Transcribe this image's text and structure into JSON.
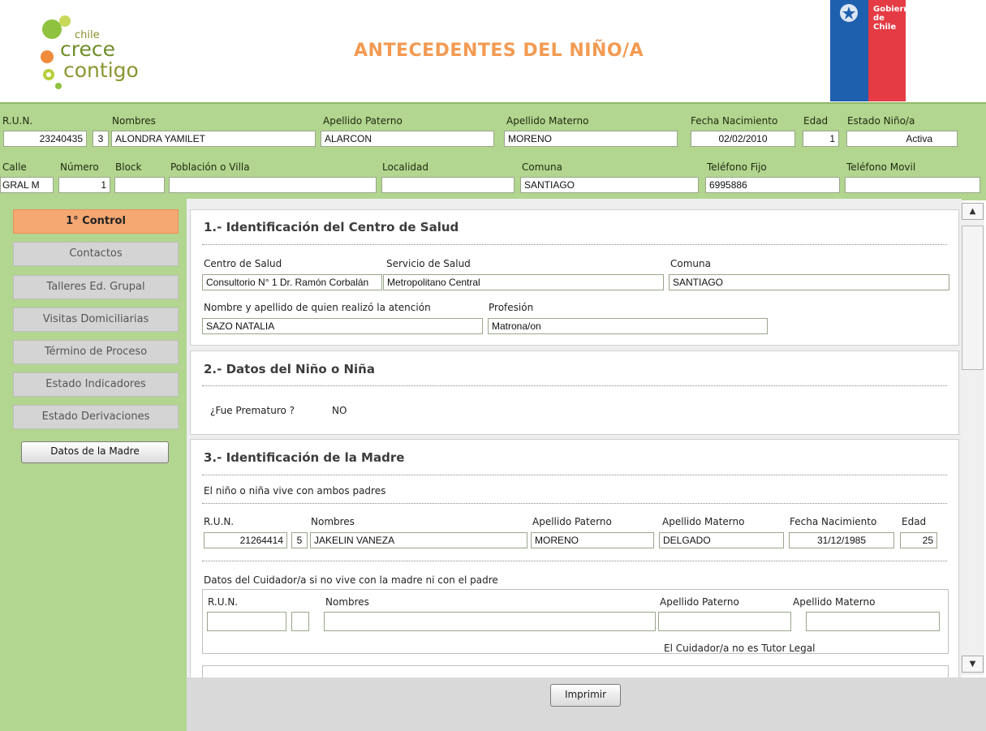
{
  "header": {
    "logo": {
      "chile": "chile",
      "line1": "crece",
      "line2": "contigo"
    },
    "title": "ANTECEDENTES DEL NIÑO/A",
    "gov_logo": {
      "line1": "Gobierno",
      "line2": "de Chile"
    }
  },
  "child": {
    "labels": {
      "run": "R.U.N.",
      "nombres": "Nombres",
      "ap_paterno": "Apellido Paterno",
      "ap_materno": "Apellido Materno",
      "fecha_nac": "Fecha Nacimiento",
      "edad": "Edad",
      "estado": "Estado Niño/a",
      "calle": "Calle",
      "numero": "Número",
      "block": "Block",
      "poblacion": "Población o Villa",
      "localidad": "Localidad",
      "comuna": "Comuna",
      "tel_fijo": "Teléfono Fijo",
      "tel_movil": "Teléfono Movil"
    },
    "values": {
      "run": "23240435",
      "dv": "3",
      "nombres": "ALONDRA YAMILET",
      "ap_paterno": "ALARCON",
      "ap_materno": "MORENO",
      "fecha_nac": "02/02/2010",
      "edad": "1",
      "estado": "Activa",
      "calle": "GRAL M",
      "numero": "1",
      "block": "",
      "poblacion": "",
      "localidad": "",
      "comuna": "SANTIAGO",
      "tel_fijo": "6995886",
      "tel_movil": ""
    }
  },
  "sidebar": {
    "items": [
      {
        "label": "1° Control",
        "active": true
      },
      {
        "label": "Contactos"
      },
      {
        "label": "Talleres Ed. Grupal"
      },
      {
        "label": "Visitas Domiciliarias"
      },
      {
        "label": "Término de Proceso"
      },
      {
        "label": "Estado Indicadores"
      },
      {
        "label": "Estado Derivaciones"
      }
    ],
    "madre_button": "Datos de la Madre"
  },
  "section1": {
    "title": "1.- Identificación del Centro de Salud",
    "labels": {
      "centro": "Centro de Salud",
      "servicio": "Servicio de Salud",
      "comuna": "Comuna",
      "nombre": "Nombre y apellido de quien realizó la atención",
      "profesion": "Profesión"
    },
    "values": {
      "centro": "Consultorio N° 1 Dr. Ramón Corbalán",
      "servicio": "Metropolitano Central",
      "comuna": "SANTIAGO",
      "nombre": "SAZO NATALIA",
      "profesion": "Matrona/on"
    }
  },
  "section2": {
    "title": "2.- Datos del Niño o Niña",
    "prematuro_label": "¿Fue Prematuro ?",
    "prematuro_value": "NO"
  },
  "section3": {
    "title": "3.- Identificación de la Madre",
    "vive_text": "El niño o niña vive con ambos padres",
    "labels": {
      "run": "R.U.N.",
      "nombres": "Nombres",
      "ap_paterno": "Apellido Paterno",
      "ap_materno": "Apellido Materno",
      "fecha_nac": "Fecha Nacimiento",
      "edad": "Edad"
    },
    "values": {
      "run": "21264414",
      "dv": "5",
      "nombres": "JAKELIN VANEZA",
      "ap_paterno": "MORENO",
      "ap_materno": "DELGADO",
      "fecha_nac": "31/12/1985",
      "edad": "25"
    },
    "cuidador_title": "Datos del Cuidador/a si no vive con la madre ni con el padre",
    "cuidador_labels": {
      "run": "R.U.N.",
      "nombres": "Nombres",
      "ap_paterno": "Apellido Paterno",
      "ap_materno": "Apellido Materno"
    },
    "cuidador_values": {
      "run": "",
      "dv": "",
      "nombres": "",
      "ap_paterno": "",
      "ap_materno": ""
    },
    "tutor_text": "El Cuidador/a no es Tutor Legal"
  },
  "footer": {
    "print_label": "Imprimir"
  },
  "colors": {
    "green": "#b2d58f",
    "orange": "#f39a52",
    "active_nav": "#f5a872",
    "gov_blue": "#1e5fae",
    "gov_red": "#e43b44"
  }
}
